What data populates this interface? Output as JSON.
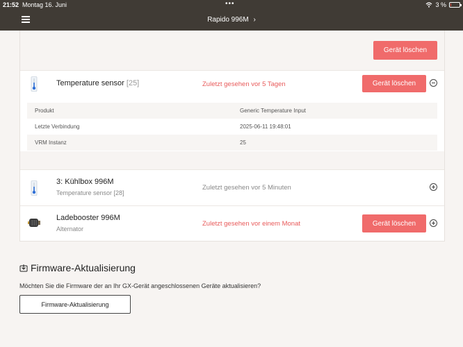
{
  "status_bar": {
    "time": "21:52",
    "date": "Montag 16. Juni",
    "battery": "3 %",
    "battery_level_percent": 3,
    "battery_color": "#e04a3f"
  },
  "nav": {
    "title": "Rapido 996M",
    "chevron": "›"
  },
  "top_delete_label": "Gerät löschen",
  "devices": [
    {
      "name": "Temperature sensor",
      "index": "[25]",
      "subtitle": "",
      "last_seen": "Zuletzt gesehen vor 5 Tagen",
      "delete_label": "Gerät löschen",
      "icon": "thermometer-icon",
      "expanded": true
    },
    {
      "name": "3: Kühlbox 996M",
      "index": "",
      "subtitle": "Temperature sensor [28]",
      "last_seen": "Zuletzt gesehen vor 5 Minuten",
      "icon": "thermometer-icon",
      "expanded": false
    },
    {
      "name": "Ladebooster 996M",
      "index": "",
      "subtitle": "Alternator",
      "last_seen": "Zuletzt gesehen vor einem Monat",
      "delete_label": "Gerät löschen",
      "icon": "alternator-icon",
      "expanded": false
    }
  ],
  "details": [
    {
      "label": "Produkt",
      "value": "Generic Temperature Input"
    },
    {
      "label": "Letzte Verbindung",
      "value": "2025-06-11 19:48:01"
    },
    {
      "label": "VRM Instanz",
      "value": "25"
    }
  ],
  "firmware": {
    "title": "Firmware-Aktualisierung",
    "description": "Möchten Sie die Firmware der an Ihr GX-Gerät angeschlossenen Geräte aktualisieren?",
    "button_label": "Firmware-Aktualisierung",
    "icon": "firmware-update-icon"
  },
  "colors": {
    "accent_red": "#f06b6b",
    "header_bg": "#403b35"
  }
}
